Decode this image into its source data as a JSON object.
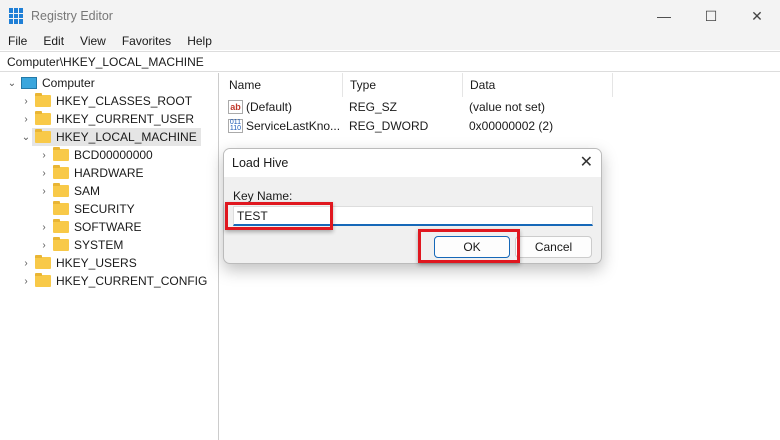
{
  "window": {
    "title": "Registry Editor",
    "minimize": "—",
    "maximize": "☐",
    "close": "✕"
  },
  "menu": [
    "File",
    "Edit",
    "View",
    "Favorites",
    "Help"
  ],
  "address": "Computer\\HKEY_LOCAL_MACHINE",
  "tree": {
    "root": "Computer",
    "hives": [
      "HKEY_CLASSES_ROOT",
      "HKEY_CURRENT_USER",
      "HKEY_LOCAL_MACHINE",
      "HKEY_USERS",
      "HKEY_CURRENT_CONFIG"
    ],
    "children": [
      "BCD00000000",
      "HARDWARE",
      "SAM",
      "SECURITY",
      "SOFTWARE",
      "SYSTEM"
    ]
  },
  "list": {
    "headers": [
      "Name",
      "Type",
      "Data"
    ],
    "rows": [
      {
        "name": "(Default)",
        "type": "REG_SZ",
        "data": "(value not set)"
      },
      {
        "name": "ServiceLastKno...",
        "type": "REG_DWORD",
        "data": "0x00000002 (2)"
      }
    ]
  },
  "dialog": {
    "title": "Load Hive",
    "close": "✕",
    "label": "Key Name:",
    "value": "TEST",
    "ok": "OK",
    "cancel": "Cancel"
  },
  "highlight_color": "#e0171f"
}
